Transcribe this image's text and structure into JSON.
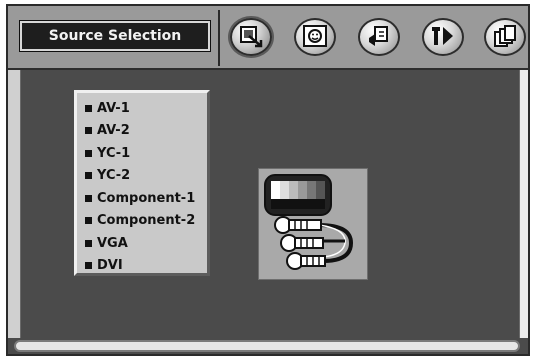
{
  "header": {
    "title": "Source Selection",
    "menu_icons": [
      {
        "name": "source-select-icon",
        "active": true
      },
      {
        "name": "picture-icon",
        "active": false
      },
      {
        "name": "audio-icon",
        "active": false
      },
      {
        "name": "setup-icon",
        "active": false
      },
      {
        "name": "utility-icon",
        "active": false
      }
    ]
  },
  "sources": [
    "AV-1",
    "AV-2",
    "YC-1",
    "YC-2",
    "Component-1",
    "Component-2",
    "VGA",
    "DVI"
  ],
  "preview_icon": "av-connector-icon",
  "colors": {
    "panel_bg": "#4b4b4b",
    "header_bg": "#9a9a9a",
    "title_bg": "#1e1e1e",
    "list_bg": "#c9c9c9"
  }
}
